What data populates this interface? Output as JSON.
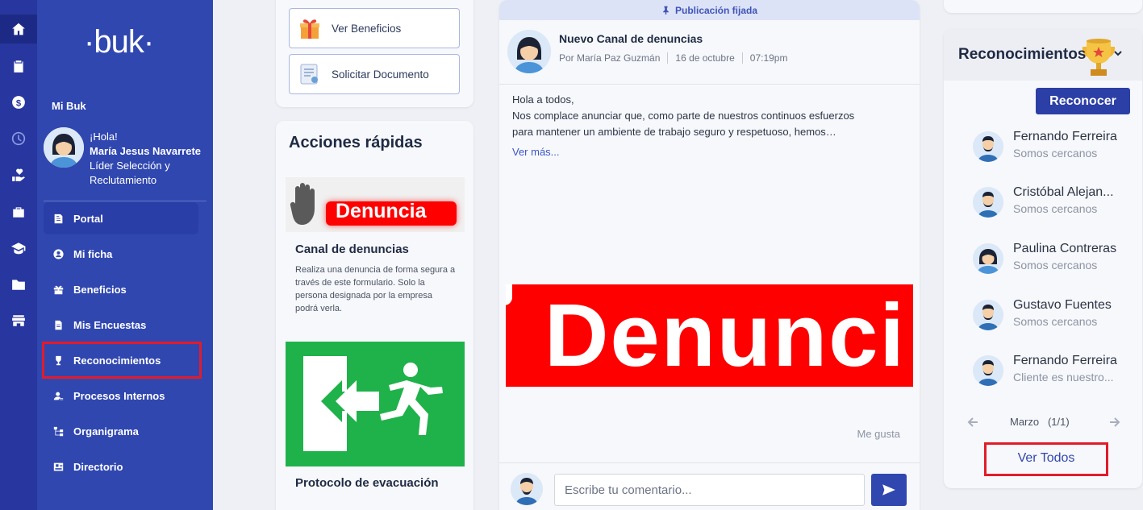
{
  "brand": {
    "logo": "·buk·",
    "primary": "#3047b0",
    "accent_red": "#e21b2b"
  },
  "rail": {
    "icons": [
      "home-icon",
      "clipboard-icon",
      "money-icon",
      "clock-icon",
      "hand-heart-icon",
      "briefcase-icon",
      "graduation-cap-icon",
      "folder-icon",
      "store-icon"
    ]
  },
  "sidebar": {
    "section_title": "Mi Buk",
    "greeting": "¡Hola!",
    "user_name": "María Jesus Navarrete",
    "user_role_line1": "Líder Selección y",
    "user_role_line2": "Reclutamiento",
    "items": [
      {
        "label": "Portal",
        "icon": "portal-icon"
      },
      {
        "label": "Mi ficha",
        "icon": "user-icon"
      },
      {
        "label": "Beneficios",
        "icon": "gift-icon"
      },
      {
        "label": "Mis Encuestas",
        "icon": "document-icon"
      },
      {
        "label": "Reconocimientos",
        "icon": "trophy-icon"
      },
      {
        "label": "Procesos Internos",
        "icon": "process-icon"
      },
      {
        "label": "Organigrama",
        "icon": "org-chart-icon"
      },
      {
        "label": "Directorio",
        "icon": "contact-card-icon"
      }
    ]
  },
  "quick_links": {
    "benefits": "Ver Beneficios",
    "request_doc": "Solicitar Documento"
  },
  "quick_actions": {
    "title": "Acciones rápidas",
    "items": [
      {
        "banner_text": "Denuncia",
        "title": "Canal de denuncias",
        "desc_line1": "Realiza una denuncia de forma segura a",
        "desc_line2": "través de este formulario. Solo la",
        "desc_line3": "persona designada por la empresa",
        "desc_line4": "podrá verla."
      },
      {
        "title": "Protocolo de evacuación"
      }
    ]
  },
  "post": {
    "pinned_label": "Publicación fijada",
    "title": "Nuevo Canal de denuncias",
    "author": "Por María Paz Guzmán",
    "date": "16 de octubre",
    "time": "07:19pm",
    "body_line1": "Hola a todos,",
    "body_line2": "Nos complace anunciar que, como parte de nuestros continuos esfuerzos",
    "body_line3": "para mantener un ambiente de trabajo seguro y respetuoso, hemos…",
    "see_more": "Ver más...",
    "banner_text": "Denunci",
    "like": "Me gusta",
    "comment_placeholder": "Escribe tu comentario..."
  },
  "recognitions": {
    "title": "Reconocimientos",
    "button": "Reconocer",
    "items": [
      {
        "name": "Fernando Ferreira",
        "value": "Somos cercanos",
        "avatar": "male"
      },
      {
        "name": "Cristóbal Alejan...",
        "value": "Somos cercanos",
        "avatar": "male"
      },
      {
        "name": "Paulina Contreras",
        "value": "Somos cercanos",
        "avatar": "female"
      },
      {
        "name": "Gustavo Fuentes",
        "value": "Somos cercanos",
        "avatar": "male"
      },
      {
        "name": "Fernando Ferreira",
        "value": "Cliente es nuestro...",
        "avatar": "male"
      }
    ],
    "pager_label": "Marzo   (1/1)",
    "see_all": "Ver Todos"
  }
}
